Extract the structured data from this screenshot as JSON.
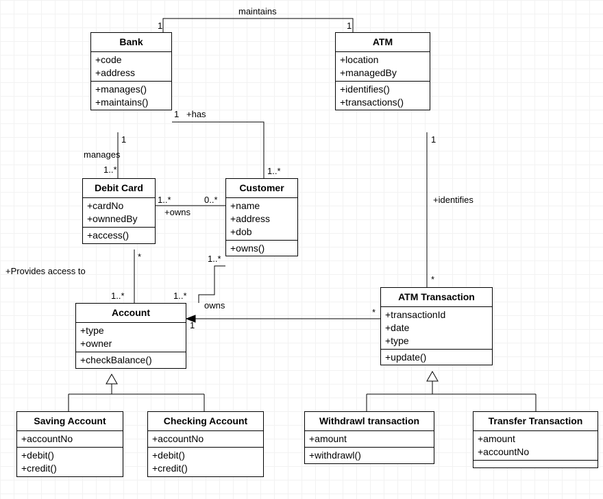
{
  "diagram_type": "uml_class_diagram",
  "classes": {
    "bank": {
      "name": "Bank",
      "attributes": [
        "+code",
        "+address"
      ],
      "methods": [
        "+manages()",
        "+maintains()"
      ]
    },
    "atm": {
      "name": "ATM",
      "attributes": [
        "+location",
        "+managedBy"
      ],
      "methods": [
        "+identifies()",
        "+transactions()"
      ]
    },
    "debitcard": {
      "name": "Debit Card",
      "attributes": [
        "+cardNo",
        "+ownnedBy"
      ],
      "methods": [
        "+access()"
      ]
    },
    "customer": {
      "name": "Customer",
      "attributes": [
        "+name",
        "+address",
        "+dob"
      ],
      "methods": [
        "+owns()"
      ]
    },
    "account": {
      "name": "Account",
      "attributes": [
        "+type",
        "+owner"
      ],
      "methods": [
        "+checkBalance()"
      ]
    },
    "atmtx": {
      "name": "ATM Transaction",
      "attributes": [
        "+transactionId",
        "+date",
        "+type"
      ],
      "methods": [
        "+update()"
      ]
    },
    "saving": {
      "name": "Saving Account",
      "attributes": [
        "+accountNo"
      ],
      "methods": [
        "+debit()",
        "+credit()"
      ]
    },
    "checking": {
      "name": "Checking Account",
      "attributes": [
        "+accountNo"
      ],
      "methods": [
        "+debit()",
        "+credit()"
      ]
    },
    "withdrawl": {
      "name": "Withdrawl transaction",
      "attributes": [
        "+amount"
      ],
      "methods": [
        "+withdrawl()"
      ]
    },
    "transfer": {
      "name": "Transfer Transaction",
      "attributes": [
        "+amount",
        "+accountNo"
      ],
      "methods": []
    }
  },
  "relationships": [
    {
      "label": "maintains",
      "from": "bank",
      "to": "atm",
      "mult_from": "1",
      "mult_to": "1"
    },
    {
      "label": "manages",
      "from": "bank",
      "to": "debitcard",
      "mult_from": "1",
      "mult_to": "1..*"
    },
    {
      "label": "+has",
      "from": "bank",
      "to": "customer",
      "mult_from": "1",
      "mult_to": "1..*"
    },
    {
      "label": "+owns",
      "from": "customer",
      "to": "debitcard",
      "mult_from": "0..*",
      "mult_to": "1..*"
    },
    {
      "label": "owns",
      "from": "customer",
      "to": "account",
      "mult_from": "1..*",
      "mult_to": "1..*"
    },
    {
      "label": "+Provides access to",
      "from": "debitcard",
      "to": "account",
      "mult_from": "*",
      "mult_to": "1..*"
    },
    {
      "label": "+identifies",
      "from": "atm",
      "to": "atmtx",
      "mult_from": "1",
      "mult_to": "*"
    },
    {
      "label": "",
      "from": "atmtx",
      "to": "account",
      "mult_from": "*",
      "mult_to": "1",
      "arrow": "to"
    },
    {
      "type": "inherit",
      "parent": "account",
      "children": [
        "saving",
        "checking"
      ]
    },
    {
      "type": "inherit",
      "parent": "atmtx",
      "children": [
        "withdrawl",
        "transfer"
      ]
    }
  ],
  "labels": {
    "maintains": "maintains",
    "manages": "manages",
    "has": "+has",
    "owns1": "+owns",
    "owns2": "owns",
    "provides": "+Provides access to",
    "identifies": "+identifies",
    "m_bank_atm_L": "1",
    "m_bank_atm_R": "1",
    "m_bank_dc_T": "1",
    "m_bank_dc_B": "1..*",
    "m_bank_cust_L": "1",
    "m_bank_cust_B": "1..*",
    "m_dc_cust_L": "1..*",
    "m_dc_cust_R": "0..*",
    "m_cust_acc_T": "1..*",
    "m_cust_acc_B": "1..*",
    "m_dc_acc_T": "*",
    "m_dc_acc_B": "1..*",
    "m_atm_tx_T": "1",
    "m_atm_tx_B": "*",
    "m_tx_acc_R": "*",
    "m_tx_acc_L": "1"
  }
}
